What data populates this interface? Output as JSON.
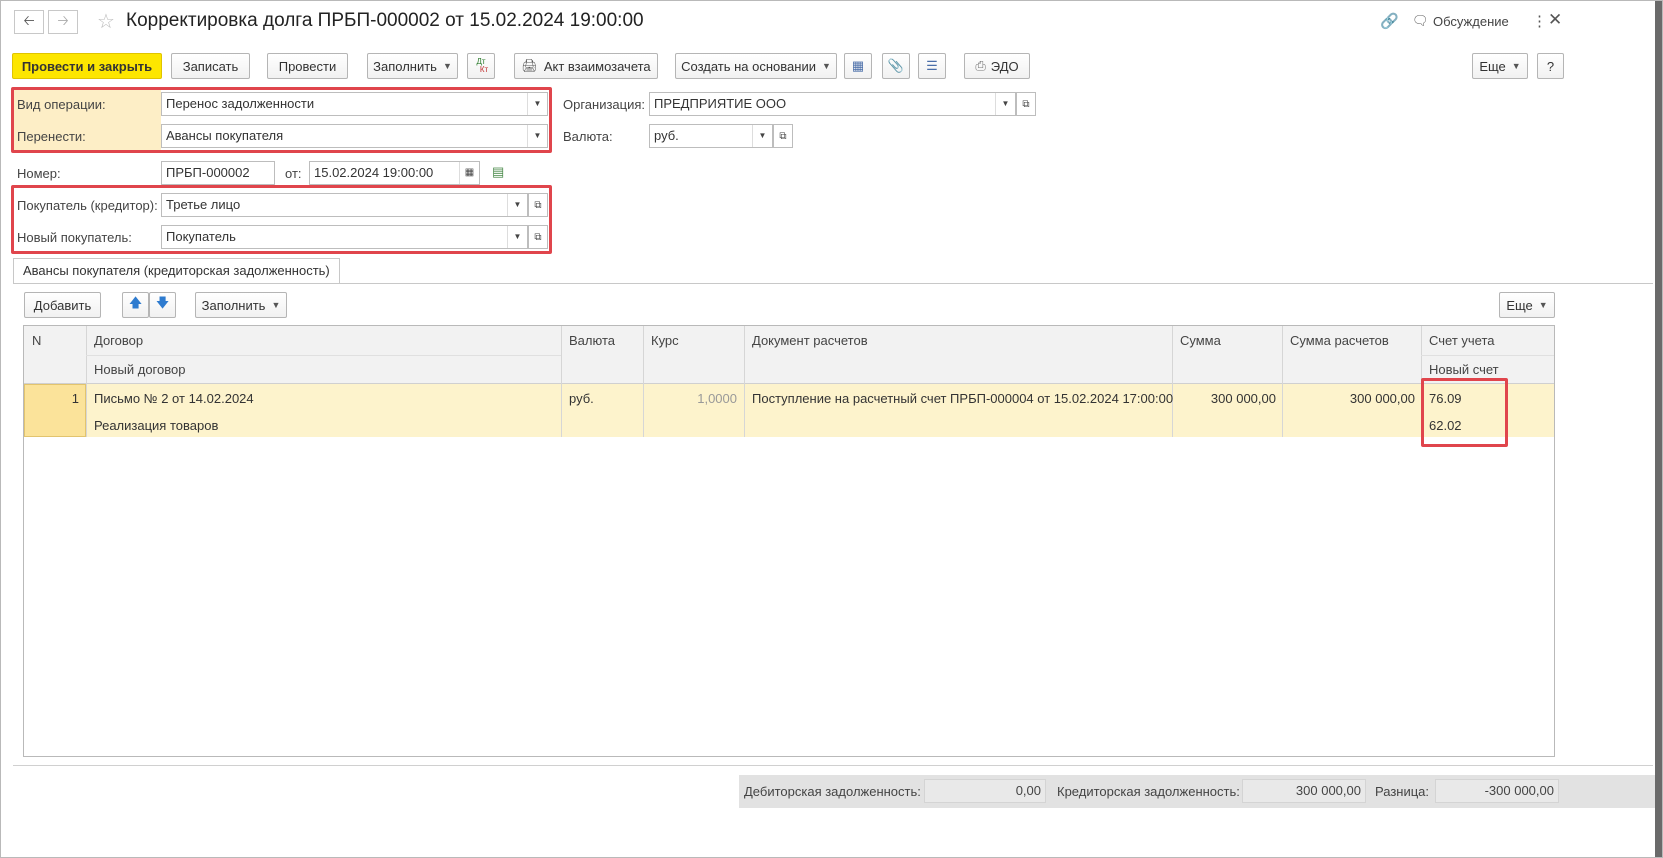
{
  "window": {
    "title": "Корректировка долга ПРБП-000002 от 15.02.2024 19:00:00",
    "discussion": "Обсуждение"
  },
  "toolbar": {
    "post_close": "Провести и закрыть",
    "save": "Записать",
    "post": "Провести",
    "fill": "Заполнить",
    "dtkt_top": "Дт",
    "dtkt_bottom": "Кт",
    "offset_act": "Акт взаимозачета",
    "create_based": "Создать на основании",
    "edo": "ЭДО",
    "more": "Еще",
    "help": "?"
  },
  "form": {
    "operation_label": "Вид операции:",
    "operation_value": "Перенос задолженности",
    "transfer_label": "Перенести:",
    "transfer_value": "Авансы покупателя",
    "org_label": "Организация:",
    "org_value": "ПРЕДПРИЯТИЕ ООО",
    "currency_label": "Валюта:",
    "currency_value": "руб.",
    "number_label": "Номер:",
    "number_value": "ПРБП-000002",
    "date_label": "от:",
    "date_value": "15.02.2024 19:00:00",
    "buyer_label": "Покупатель (кредитор):",
    "buyer_value": "Третье лицо",
    "new_buyer_label": "Новый покупатель:",
    "new_buyer_value": "Покупатель"
  },
  "tab": {
    "label": "Авансы покупателя (кредиторская задолженность)"
  },
  "table_toolbar": {
    "add": "Добавить",
    "fill": "Заполнить",
    "more": "Еще"
  },
  "table": {
    "headers": {
      "n": "N",
      "contract": "Договор",
      "new_contract": "Новый договор",
      "currency": "Валюта",
      "rate": "Курс",
      "doc": "Документ расчетов",
      "sum": "Сумма",
      "sum_calc": "Сумма расчетов",
      "account": "Счет учета",
      "new_account": "Новый счет"
    },
    "rows": [
      {
        "n": "1",
        "contract": "Письмо № 2 от 14.02.2024",
        "new_contract": "Реализация товаров",
        "currency": "руб.",
        "rate": "1,0000",
        "doc": "Поступление на расчетный счет ПРБП-000004 от 15.02.2024 17:00:00",
        "sum": "300 000,00",
        "sum_calc": "300 000,00",
        "account": "76.09",
        "new_account": "62.02"
      }
    ]
  },
  "footer": {
    "debit_label": "Дебиторская задолженность:",
    "debit_value": "0,00",
    "credit_label": "Кредиторская задолженность:",
    "credit_value": "300 000,00",
    "diff_label": "Разница:",
    "diff_value": "-300 000,00"
  },
  "colors": {
    "primary_button": "#fde600",
    "highlight_box": "#e0454c",
    "selected_row": "#fdf3cc"
  }
}
